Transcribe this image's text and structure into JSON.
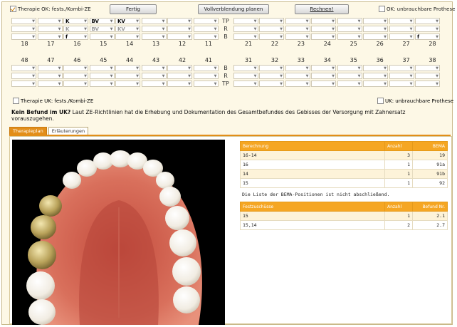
{
  "topbar": {
    "therapy_ok_label": "Therapie OK: fests./Kombi-ZE",
    "therapy_ok_checked": true,
    "btn_fertig": "Fertig",
    "btn_vollverblendung": "Vollverblendung planen",
    "btn_rechnen": "Rechnen!",
    "uk_unbrauchbar_top": "OK: unbrauchbare Prothese"
  },
  "upper": {
    "row_labels": [
      "TP",
      "R",
      "B"
    ],
    "tp_left": [
      "",
      "",
      "K",
      "BV",
      "KV",
      "",
      "",
      ""
    ],
    "r_left": [
      "",
      "",
      "K",
      "BV",
      "KV",
      "",
      "",
      ""
    ],
    "b_left": [
      "",
      "",
      "f",
      "",
      "",
      "",
      "",
      ""
    ],
    "tp_right": [
      "",
      "",
      "",
      "",
      "",
      "",
      "",
      ""
    ],
    "r_right": [
      "",
      "",
      "",
      "",
      "",
      "",
      "",
      ""
    ],
    "b_right": [
      "",
      "",
      "",
      "",
      "",
      "",
      "",
      "f"
    ],
    "teeth_left": [
      "18",
      "17",
      "16",
      "15",
      "14",
      "13",
      "12",
      "11"
    ],
    "teeth_right": [
      "21",
      "22",
      "23",
      "24",
      "25",
      "26",
      "27",
      "28"
    ]
  },
  "lower": {
    "teeth_left": [
      "48",
      "47",
      "46",
      "45",
      "44",
      "43",
      "42",
      "41"
    ],
    "teeth_right": [
      "31",
      "32",
      "33",
      "34",
      "35",
      "36",
      "37",
      "38"
    ],
    "row_labels": [
      "B",
      "R",
      "TP"
    ]
  },
  "bottombar": {
    "therapy_uk_label": "Therapie UK: fests./Kombi-ZE",
    "uk_unbrauchbar": "UK: unbrauchbare Prothese"
  },
  "question": {
    "bold": "Kein Befund im UK?",
    "text": " Laut ZE-Richtlinien hat die Erhebung und Dokumentation des Gesamtbefundes des Gebisses der Versorgung mit Zahnersatz vorauszugehen."
  },
  "tabs": [
    "Therapieplan",
    "Erläuterungen"
  ],
  "berechnung": {
    "headers": [
      "Berechnung",
      "Anzahl",
      "BEMA"
    ],
    "rows": [
      [
        "16-14",
        "3",
        "19"
      ],
      [
        "16",
        "1",
        "91a"
      ],
      [
        "14",
        "1",
        "91b"
      ],
      [
        "15",
        "1",
        "92"
      ]
    ]
  },
  "note": "Die Liste der BEMA-Positionen ist nicht abschließend.",
  "festzuschuesse": {
    "headers": [
      "Festzuschüsse",
      "Anzahl",
      "Befund Nr."
    ],
    "rows": [
      [
        "15",
        "1",
        "2.1"
      ],
      [
        "15,14",
        "2",
        "2.7"
      ]
    ]
  },
  "colors": {
    "accent": "#e28e19",
    "header_bg": "#f5a623",
    "panel_bg": "#fdf8e6"
  }
}
